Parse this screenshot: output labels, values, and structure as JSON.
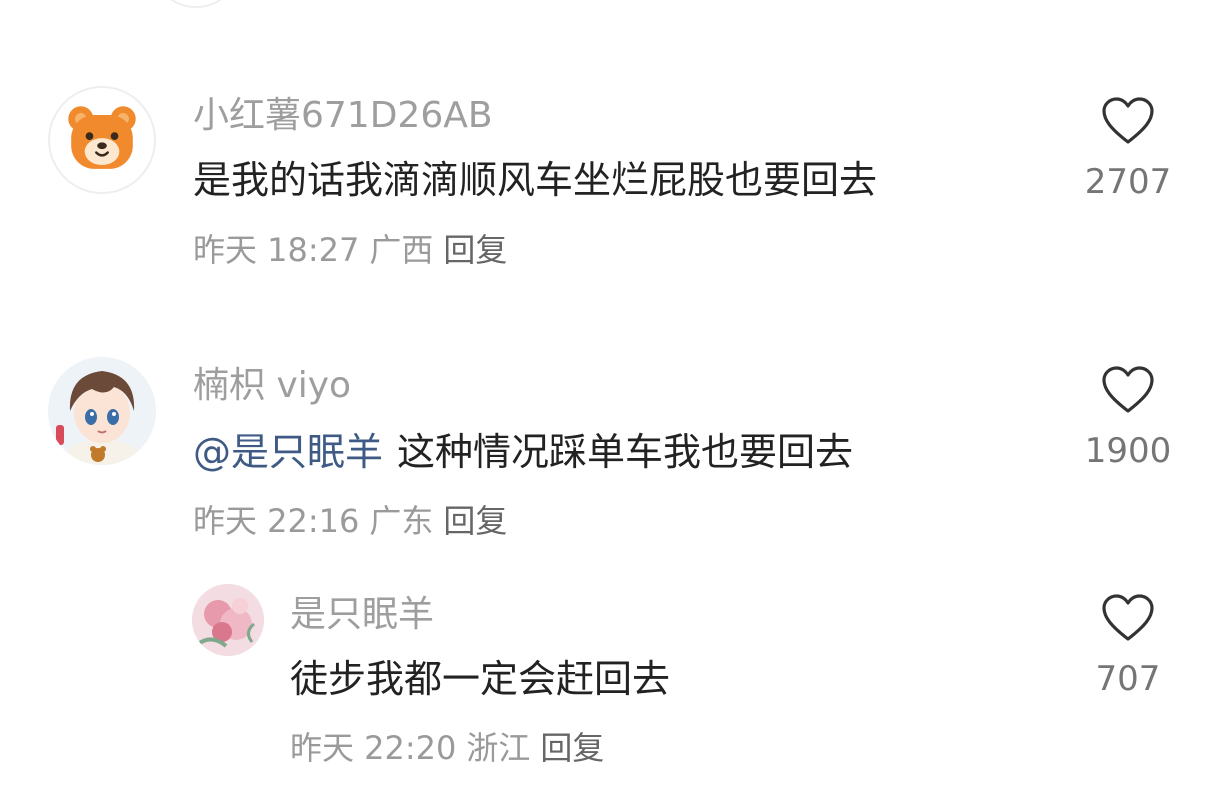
{
  "comments": [
    {
      "username": "小红薯671D26AB",
      "text": "是我的话我滴滴顺风车坐烂屁股也要回去",
      "mention": "",
      "time": "昨天 18:27",
      "location": "广西",
      "reply_label": "回复",
      "likes": "2707",
      "avatar_icon": "bear-avatar-icon"
    },
    {
      "username": "楠枳 viyo",
      "mention": "@是只眠羊",
      "text": "这种情况踩单车我也要回去",
      "time": "昨天 22:16",
      "location": "广东",
      "reply_label": "回复",
      "likes": "1900",
      "avatar_icon": "anime-boy-avatar-icon"
    },
    {
      "username": "是只眠羊",
      "text": "徒步我都一定会赶回去",
      "mention": "",
      "time": "昨天 22:20",
      "location": "浙江",
      "reply_label": "回复",
      "likes": "707",
      "avatar_icon": "flower-avatar-icon",
      "is_reply": true
    }
  ],
  "colors": {
    "username": "#9e9e9e",
    "text": "#222222",
    "mention": "#3f5b85",
    "meta": "#9a9a9a",
    "bear_orange": "#f08a2c"
  }
}
